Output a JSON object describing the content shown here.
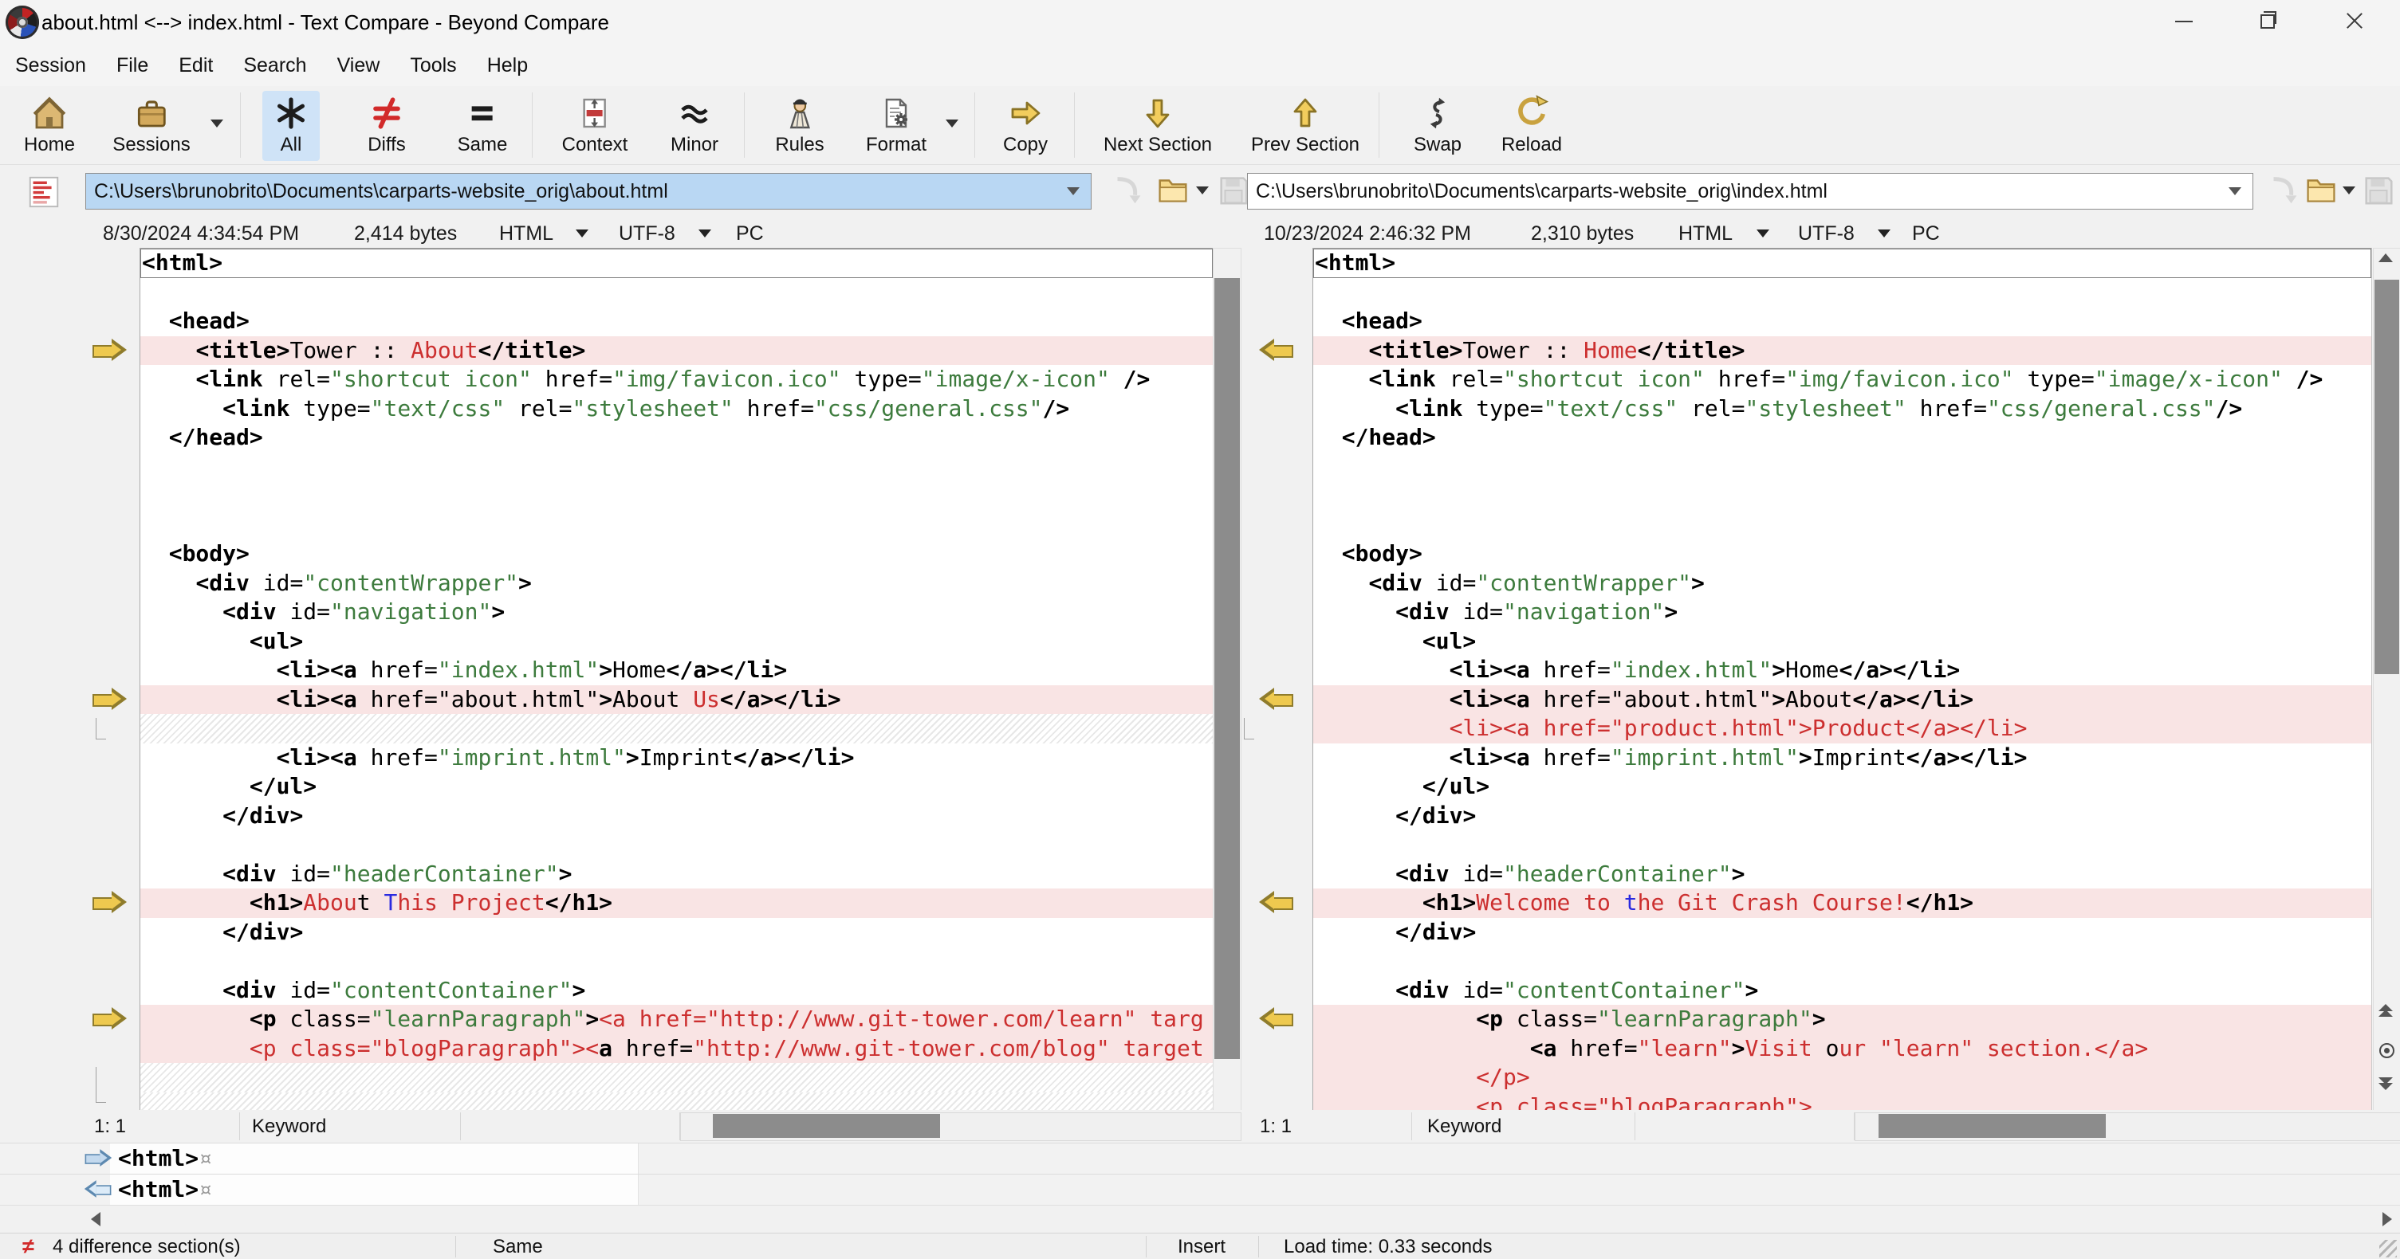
{
  "window": {
    "title": "about.html <--> index.html - Text Compare - Beyond Compare",
    "controls": {
      "minimize": "minimize",
      "restore": "restore",
      "close": "close"
    }
  },
  "menu": {
    "items": [
      "Session",
      "File",
      "Edit",
      "Search",
      "View",
      "Tools",
      "Help"
    ]
  },
  "toolbar": {
    "buttons": [
      {
        "label": "Home",
        "icon": "home-icon"
      },
      {
        "label": "Sessions",
        "icon": "sessions-icon",
        "dropdown": true
      },
      {
        "label": "All",
        "icon": "asterisk-icon",
        "active": true
      },
      {
        "label": "Diffs",
        "icon": "not-equal-icon"
      },
      {
        "label": "Same",
        "icon": "equal-icon"
      },
      {
        "label": "Context",
        "icon": "context-icon"
      },
      {
        "label": "Minor",
        "icon": "approx-icon"
      },
      {
        "label": "Rules",
        "icon": "referee-icon"
      },
      {
        "label": "Format",
        "icon": "format-icon",
        "dropdown": true
      },
      {
        "label": "Copy",
        "icon": "arrow-right-icon"
      },
      {
        "label": "Next Section",
        "icon": "arrow-down-icon"
      },
      {
        "label": "Prev Section",
        "icon": "arrow-up-icon"
      },
      {
        "label": "Swap",
        "icon": "swap-icon"
      },
      {
        "label": "Reload",
        "icon": "reload-icon"
      }
    ]
  },
  "left_pane": {
    "path": "C:\\Users\\brunobrito\\Documents\\carparts-website_orig\\about.html",
    "selected": true,
    "modified": "8/30/2024 4:34:54 PM",
    "size": "2,414 bytes",
    "format": "HTML",
    "encoding": "UTF-8",
    "line_ending": "PC",
    "cursor": "1: 1",
    "syntax": "Keyword",
    "file_buttons": [
      "dropdown-chevron",
      "sync-arrow",
      "folder-open",
      "save"
    ]
  },
  "right_pane": {
    "path": "C:\\Users\\brunobrito\\Documents\\carparts-website_orig\\index.html",
    "selected": false,
    "modified": "10/23/2024 2:46:32 PM",
    "size": "2,310 bytes",
    "format": "HTML",
    "encoding": "UTF-8",
    "line_ending": "PC",
    "cursor": "1: 1",
    "syntax": "Keyword",
    "file_buttons": [
      "dropdown-chevron",
      "sync-arrow",
      "folder-open",
      "save"
    ]
  },
  "code": {
    "left_lines": [
      {
        "box": 1,
        "s": [
          [
            "k",
            "<html>"
          ]
        ]
      },
      {
        "s": []
      },
      {
        "s": [
          [
            "t",
            "  "
          ],
          [
            "k",
            "<head>"
          ]
        ]
      },
      {
        "bg": "d",
        "g": 1,
        "s": [
          [
            "t",
            "    "
          ],
          [
            "k",
            "<title>"
          ],
          [
            "t",
            "Tower :: "
          ],
          [
            "r",
            "About"
          ],
          [
            "k",
            "</title>"
          ]
        ]
      },
      {
        "s": [
          [
            "t",
            "    "
          ],
          [
            "k",
            "<link"
          ],
          [
            "t",
            " rel="
          ],
          [
            "s",
            "\"shortcut icon\""
          ],
          [
            "t",
            " href="
          ],
          [
            "s",
            "\"img/favicon.ico\""
          ],
          [
            "t",
            " type="
          ],
          [
            "s",
            "\"image/x-icon\""
          ],
          [
            "t",
            " "
          ],
          [
            "k",
            "/>"
          ]
        ]
      },
      {
        "s": [
          [
            "t",
            "      "
          ],
          [
            "k",
            "<link"
          ],
          [
            "t",
            " type="
          ],
          [
            "s",
            "\"text/css\""
          ],
          [
            "t",
            " rel="
          ],
          [
            "s",
            "\"stylesheet\""
          ],
          [
            "t",
            " href="
          ],
          [
            "s",
            "\"css/general.css\""
          ],
          [
            "k",
            "/>"
          ]
        ]
      },
      {
        "s": [
          [
            "t",
            "  "
          ],
          [
            "k",
            "</head>"
          ]
        ]
      },
      {
        "s": []
      },
      {
        "s": []
      },
      {
        "s": []
      },
      {
        "s": [
          [
            "t",
            "  "
          ],
          [
            "k",
            "<body>"
          ]
        ]
      },
      {
        "s": [
          [
            "t",
            "    "
          ],
          [
            "k",
            "<div"
          ],
          [
            "t",
            " id="
          ],
          [
            "s",
            "\"contentWrapper\""
          ],
          [
            "k",
            ">"
          ]
        ]
      },
      {
        "s": [
          [
            "t",
            "      "
          ],
          [
            "k",
            "<div"
          ],
          [
            "t",
            " id="
          ],
          [
            "s",
            "\"navigation\""
          ],
          [
            "k",
            ">"
          ]
        ]
      },
      {
        "s": [
          [
            "t",
            "        "
          ],
          [
            "k",
            "<ul>"
          ]
        ]
      },
      {
        "s": [
          [
            "t",
            "          "
          ],
          [
            "k",
            "<li><a"
          ],
          [
            "t",
            " href="
          ],
          [
            "s",
            "\"index.html\""
          ],
          [
            "k",
            ">"
          ],
          [
            "t",
            "Home"
          ],
          [
            "k",
            "</a></li>"
          ]
        ]
      },
      {
        "bg": "d",
        "g": 1,
        "s": [
          [
            "t",
            "          "
          ],
          [
            "k",
            "<li><a"
          ],
          [
            "t",
            " href="
          ],
          [
            "t",
            "\"about.html\""
          ],
          [
            "k",
            ">"
          ],
          [
            "t",
            "About "
          ],
          [
            "r",
            "Us"
          ],
          [
            "k",
            "</a></li>"
          ]
        ]
      },
      {
        "bg": "x",
        "s": []
      },
      {
        "s": [
          [
            "t",
            "          "
          ],
          [
            "k",
            "<li><a"
          ],
          [
            "t",
            " href="
          ],
          [
            "s",
            "\"imprint.html\""
          ],
          [
            "k",
            ">"
          ],
          [
            "t",
            "Imprint"
          ],
          [
            "k",
            "</a></li>"
          ]
        ]
      },
      {
        "s": [
          [
            "t",
            "        "
          ],
          [
            "k",
            "</ul>"
          ]
        ]
      },
      {
        "s": [
          [
            "t",
            "      "
          ],
          [
            "k",
            "</div>"
          ]
        ]
      },
      {
        "s": []
      },
      {
        "s": [
          [
            "t",
            "      "
          ],
          [
            "k",
            "<div"
          ],
          [
            "t",
            " id="
          ],
          [
            "s",
            "\"headerContainer\""
          ],
          [
            "k",
            ">"
          ]
        ]
      },
      {
        "bg": "d",
        "g": 1,
        "s": [
          [
            "t",
            "        "
          ],
          [
            "k",
            "<h1>"
          ],
          [
            "r",
            "Abou"
          ],
          [
            "t",
            "t "
          ],
          [
            "b",
            "T"
          ],
          [
            "r",
            "his Project"
          ],
          [
            "k",
            "</h1>"
          ]
        ]
      },
      {
        "s": [
          [
            "t",
            "      "
          ],
          [
            "k",
            "</div>"
          ]
        ]
      },
      {
        "s": []
      },
      {
        "s": [
          [
            "t",
            "      "
          ],
          [
            "k",
            "<div"
          ],
          [
            "t",
            " id="
          ],
          [
            "s",
            "\"contentContainer\""
          ],
          [
            "k",
            ">"
          ]
        ]
      },
      {
        "bg": "d",
        "g": 1,
        "s": [
          [
            "t",
            "        "
          ],
          [
            "k",
            "<p"
          ],
          [
            "t",
            " class="
          ],
          [
            "s",
            "\"learnParagraph\""
          ],
          [
            "k",
            ">"
          ],
          [
            "r",
            "<a href=\"http://www.git-tower.com/learn\" targ"
          ]
        ]
      },
      {
        "bg": "d",
        "s": [
          [
            "t",
            "        "
          ],
          [
            "r",
            "<p class=\"blogParagraph\"><"
          ],
          [
            "k",
            "a"
          ],
          [
            "t",
            " href="
          ],
          [
            "r",
            "\"http://www.git-tower.com/blog\" target"
          ]
        ]
      },
      {
        "bg": "x",
        "s": []
      },
      {
        "bg": "x",
        "s": []
      }
    ],
    "right_lines": [
      {
        "box": 1,
        "s": [
          [
            "k",
            "<html>"
          ]
        ]
      },
      {
        "s": []
      },
      {
        "s": [
          [
            "t",
            "  "
          ],
          [
            "k",
            "<head>"
          ]
        ]
      },
      {
        "bg": "d",
        "g": 1,
        "s": [
          [
            "t",
            "    "
          ],
          [
            "k",
            "<title>"
          ],
          [
            "t",
            "Tower :: "
          ],
          [
            "r",
            "Home"
          ],
          [
            "k",
            "</title>"
          ]
        ]
      },
      {
        "s": [
          [
            "t",
            "    "
          ],
          [
            "k",
            "<link"
          ],
          [
            "t",
            " rel="
          ],
          [
            "s",
            "\"shortcut icon\""
          ],
          [
            "t",
            " href="
          ],
          [
            "s",
            "\"img/favicon.ico\""
          ],
          [
            "t",
            " type="
          ],
          [
            "s",
            "\"image/x-icon\""
          ],
          [
            "t",
            " "
          ],
          [
            "k",
            "/>"
          ]
        ]
      },
      {
        "s": [
          [
            "t",
            "      "
          ],
          [
            "k",
            "<link"
          ],
          [
            "t",
            " type="
          ],
          [
            "s",
            "\"text/css\""
          ],
          [
            "t",
            " rel="
          ],
          [
            "s",
            "\"stylesheet\""
          ],
          [
            "t",
            " href="
          ],
          [
            "s",
            "\"css/general.css\""
          ],
          [
            "k",
            "/>"
          ]
        ]
      },
      {
        "s": [
          [
            "t",
            "  "
          ],
          [
            "k",
            "</head>"
          ]
        ]
      },
      {
        "s": []
      },
      {
        "s": []
      },
      {
        "s": []
      },
      {
        "s": [
          [
            "t",
            "  "
          ],
          [
            "k",
            "<body>"
          ]
        ]
      },
      {
        "s": [
          [
            "t",
            "    "
          ],
          [
            "k",
            "<div"
          ],
          [
            "t",
            " id="
          ],
          [
            "s",
            "\"contentWrapper\""
          ],
          [
            "k",
            ">"
          ]
        ]
      },
      {
        "s": [
          [
            "t",
            "      "
          ],
          [
            "k",
            "<div"
          ],
          [
            "t",
            " id="
          ],
          [
            "s",
            "\"navigation\""
          ],
          [
            "k",
            ">"
          ]
        ]
      },
      {
        "s": [
          [
            "t",
            "        "
          ],
          [
            "k",
            "<ul>"
          ]
        ]
      },
      {
        "s": [
          [
            "t",
            "          "
          ],
          [
            "k",
            "<li><a"
          ],
          [
            "t",
            " href="
          ],
          [
            "s",
            "\"index.html\""
          ],
          [
            "k",
            ">"
          ],
          [
            "t",
            "Home"
          ],
          [
            "k",
            "</a></li>"
          ]
        ]
      },
      {
        "bg": "d",
        "g": 1,
        "s": [
          [
            "t",
            "          "
          ],
          [
            "k",
            "<li><a"
          ],
          [
            "t",
            " href="
          ],
          [
            "t",
            "\"about.html\""
          ],
          [
            "k",
            ">"
          ],
          [
            "t",
            "About"
          ],
          [
            "k",
            "</a></li>"
          ]
        ]
      },
      {
        "bg": "d",
        "s": [
          [
            "r",
            "          <li><a href=\"product.html\">Product</a></li>"
          ]
        ]
      },
      {
        "s": [
          [
            "t",
            "          "
          ],
          [
            "k",
            "<li><a"
          ],
          [
            "t",
            " href="
          ],
          [
            "s",
            "\"imprint.html\""
          ],
          [
            "k",
            ">"
          ],
          [
            "t",
            "Imprint"
          ],
          [
            "k",
            "</a></li>"
          ]
        ]
      },
      {
        "s": [
          [
            "t",
            "        "
          ],
          [
            "k",
            "</ul>"
          ]
        ]
      },
      {
        "s": [
          [
            "t",
            "      "
          ],
          [
            "k",
            "</div>"
          ]
        ]
      },
      {
        "s": []
      },
      {
        "s": [
          [
            "t",
            "      "
          ],
          [
            "k",
            "<div"
          ],
          [
            "t",
            " id="
          ],
          [
            "s",
            "\"headerContainer\""
          ],
          [
            "k",
            ">"
          ]
        ]
      },
      {
        "bg": "d",
        "g": 1,
        "s": [
          [
            "t",
            "        "
          ],
          [
            "k",
            "<h1>"
          ],
          [
            "r",
            "Welcome to "
          ],
          [
            "b",
            "t"
          ],
          [
            "r",
            "he Git Crash Course!"
          ],
          [
            "k",
            "</h1>"
          ]
        ]
      },
      {
        "s": [
          [
            "t",
            "      "
          ],
          [
            "k",
            "</div>"
          ]
        ]
      },
      {
        "s": []
      },
      {
        "s": [
          [
            "t",
            "      "
          ],
          [
            "k",
            "<div"
          ],
          [
            "t",
            " id="
          ],
          [
            "s",
            "\"contentContainer\""
          ],
          [
            "k",
            ">"
          ]
        ]
      },
      {
        "bg": "d",
        "g": 1,
        "s": [
          [
            "t",
            "            "
          ],
          [
            "k",
            "<p"
          ],
          [
            "t",
            " class="
          ],
          [
            "s",
            "\"learnParagraph\""
          ],
          [
            "k",
            ">"
          ]
        ]
      },
      {
        "bg": "d",
        "s": [
          [
            "t",
            "                "
          ],
          [
            "k",
            "<a"
          ],
          [
            "t",
            " href="
          ],
          [
            "r",
            "\"learn\""
          ],
          [
            "k",
            ">"
          ],
          [
            "r",
            "Visit "
          ],
          [
            "t",
            "o"
          ],
          [
            "r",
            "ur \"learn\" section."
          ],
          [
            "r",
            "</a>"
          ]
        ]
      },
      {
        "bg": "d",
        "s": [
          [
            "t",
            "            "
          ],
          [
            "r",
            "</p>"
          ]
        ]
      },
      {
        "bg": "d",
        "s": [
          [
            "t",
            "            "
          ],
          [
            "r",
            "<p class=\"blogParagraph\">"
          ]
        ]
      }
    ]
  },
  "detail_pane": {
    "rows": [
      {
        "arrow": "right",
        "text": "<html>",
        "eol": "¤"
      },
      {
        "arrow": "left",
        "text": "<html>",
        "eol": "¤"
      }
    ]
  },
  "status_bar": {
    "diff_icon": "≠",
    "differences": "4 difference section(s)",
    "same": "Same",
    "insert_mode": "Insert",
    "load_time": "Load time: 0.33 seconds"
  },
  "colors": {
    "diff_row_bg": "#f9e4e4",
    "diff_text": "#cc2f2f",
    "minor_diff_text": "#2a2ae0",
    "string_text": "#3d7b3d",
    "section_arrow": "#eec94f",
    "selected_path_bg": "#b9d7f3"
  }
}
